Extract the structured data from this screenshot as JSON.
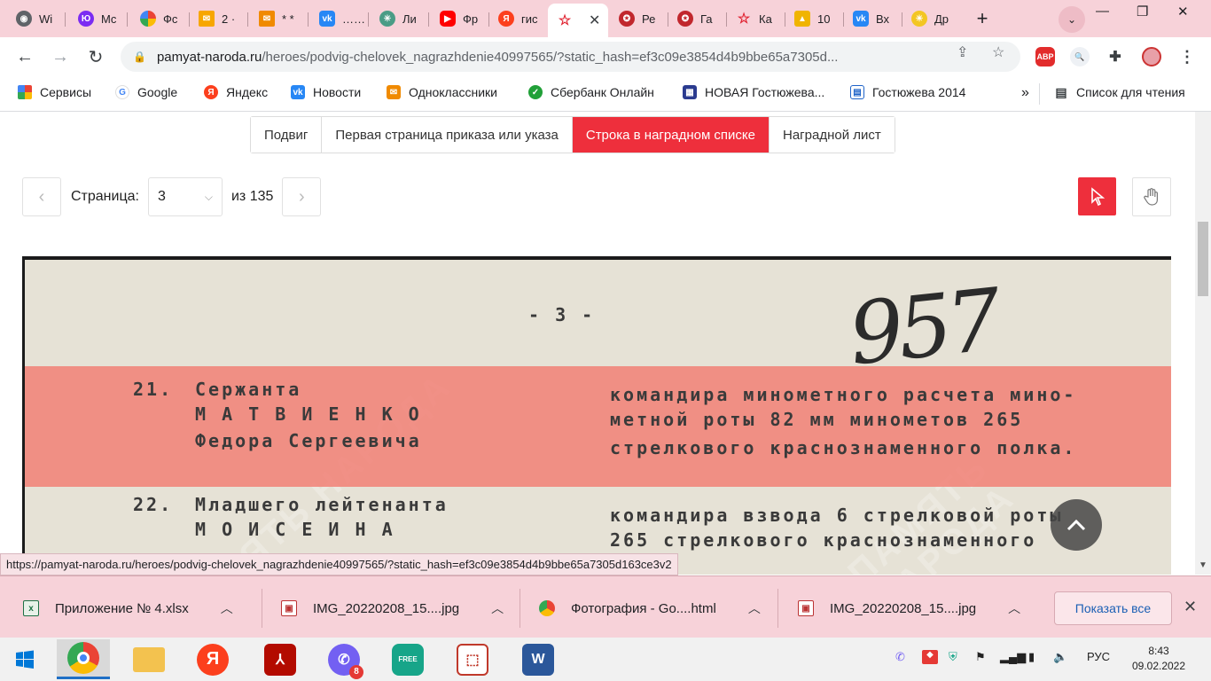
{
  "tabs": [
    {
      "label": "Wi",
      "icon": "chrome-icon",
      "color": "#5f6368"
    },
    {
      "label": "Mc",
      "icon": "yandex-money-icon",
      "color": "#7b2cf2"
    },
    {
      "label": "Фс",
      "icon": "google-photos-icon",
      "color": "#f4b400"
    },
    {
      "label": "2 ·",
      "icon": "mail-icon",
      "color": "#f7a600"
    },
    {
      "label": "* *",
      "icon": "mail-envelope-icon",
      "color": "#f08a00"
    },
    {
      "label": "……",
      "icon": "vk-icon",
      "color": "#2787f5"
    },
    {
      "label": "Ли",
      "icon": "compass-icon",
      "color": "#4a9c86"
    },
    {
      "label": "Фр",
      "icon": "youtube-icon",
      "color": "#ff0000"
    },
    {
      "label": "гис",
      "icon": "yandex-icon",
      "color": "#fc3f1d"
    },
    {
      "label": "",
      "icon": "star-icon",
      "color": "#e0202e",
      "active": true
    },
    {
      "label": "Ре",
      "icon": "medal-icon",
      "color": "#c1272d"
    },
    {
      "label": "Га",
      "icon": "medal-icon",
      "color": "#c1272d"
    },
    {
      "label": "Ка",
      "icon": "star-icon",
      "color": "#e0202e"
    },
    {
      "label": "10",
      "icon": "photo-icon",
      "color": "#f0b400"
    },
    {
      "label": "Вх",
      "icon": "vk-icon",
      "color": "#2787f5"
    },
    {
      "label": "Др",
      "icon": "sun-icon",
      "color": "#f3c623"
    }
  ],
  "address": {
    "host": "pamyat-naroda.ru",
    "path": "/heroes/podvig-chelovek_nagrazhdenie40997565/?static_hash=ef3c09e3854d4b9bbe65a7305d..."
  },
  "extensions": {
    "abp": "ABP"
  },
  "bookmarks": [
    {
      "label": "Сервисы",
      "icon": "apps-grid-icon"
    },
    {
      "label": "Google",
      "icon": "google-icon"
    },
    {
      "label": "Яндекс",
      "icon": "yandex-icon"
    },
    {
      "label": "Новости",
      "icon": "vk-icon"
    },
    {
      "label": "Одноклассники",
      "icon": "mail-envelope-icon"
    },
    {
      "label": "Сбербанк Онлайн",
      "icon": "sberbank-icon"
    },
    {
      "label": "НОВАЯ Гостюжева...",
      "icon": "bookmark-page-icon"
    },
    {
      "label": "Гостюжева 2014",
      "icon": "bookmark-page-icon"
    }
  ],
  "bookmarks_more": "»",
  "reading_list": "Список для чтения",
  "doc_tabs": [
    {
      "label": "Подвиг",
      "active": false
    },
    {
      "label": "Первая страница приказа или указа",
      "active": false
    },
    {
      "label": "Строка в наградном списке",
      "active": true
    },
    {
      "label": "Наградной лист",
      "active": false
    }
  ],
  "pager": {
    "label": "Страница:",
    "current": "3",
    "of_text": "из 135"
  },
  "scan": {
    "page_mark": "- 3 -",
    "handwritten": "957",
    "rows": [
      {
        "num": "21.",
        "rank": "Сержанта",
        "surname": "М А Т В И Е Н К О",
        "name": "Федора Сергеевича",
        "pos1": "командира минометного расчета мино-",
        "pos2": "метной роты 82 мм минометов 265",
        "pos3": "стрелкового краснознаменного полка."
      },
      {
        "num": "22.",
        "rank": "Младшего лейтенанта",
        "surname": "М О И С Е И Н А",
        "pos1": "командира взвода 6 стрелковой роты",
        "pos2": "265 стрелкового краснознаменного"
      }
    ],
    "watermark": "ПАМЯТЬ НАРОДА"
  },
  "status_url": "https://pamyat-naroda.ru/heroes/podvig-chelovek_nagrazhdenie40997565/?static_hash=ef3c09e3854d4b9bbe65a7305d163ce3v2",
  "downloads": [
    {
      "name": "Приложение № 4.xlsx",
      "icon": "excel-file-icon"
    },
    {
      "name": "IMG_20220208_15....jpg",
      "icon": "image-file-icon"
    },
    {
      "name": "Фотография - Go....html",
      "icon": "chrome-file-icon"
    },
    {
      "name": "IMG_20220208_15....jpg",
      "icon": "image-file-icon"
    }
  ],
  "show_all": "Показать все",
  "taskbar": {
    "viber_badge": "8",
    "free_label": "FREE",
    "lang": "РУС",
    "time": "8:43",
    "date": "09.02.2022"
  }
}
